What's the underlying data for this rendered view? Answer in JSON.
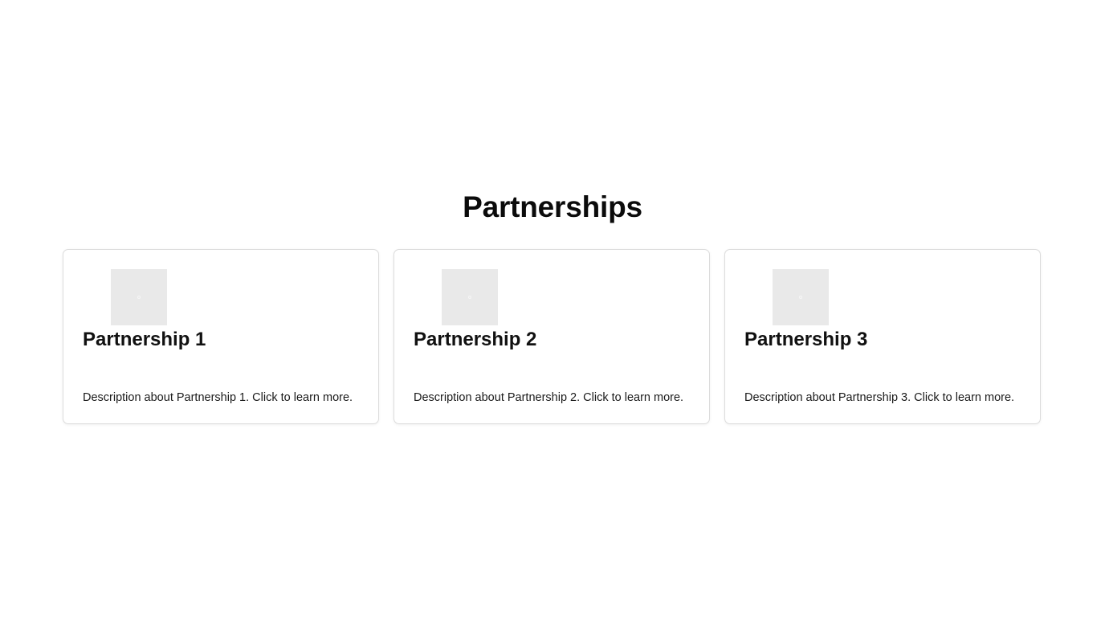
{
  "section": {
    "title": "Partnerships"
  },
  "partners": [
    {
      "title": "Partnership 1",
      "description": "Description about Partnership 1. Click to learn more.",
      "logo_icon": "image-placeholder-icon"
    },
    {
      "title": "Partnership 2",
      "description": "Description about Partnership 2. Click to learn more.",
      "logo_icon": "image-placeholder-icon"
    },
    {
      "title": "Partnership 3",
      "description": "Description about Partnership 3. Click to learn more.",
      "logo_icon": "image-placeholder-icon"
    }
  ],
  "colors": {
    "background": "#ffffff",
    "card_border": "#dcdcdc",
    "logo_placeholder": "#e9e9e9",
    "text": "#111111"
  }
}
